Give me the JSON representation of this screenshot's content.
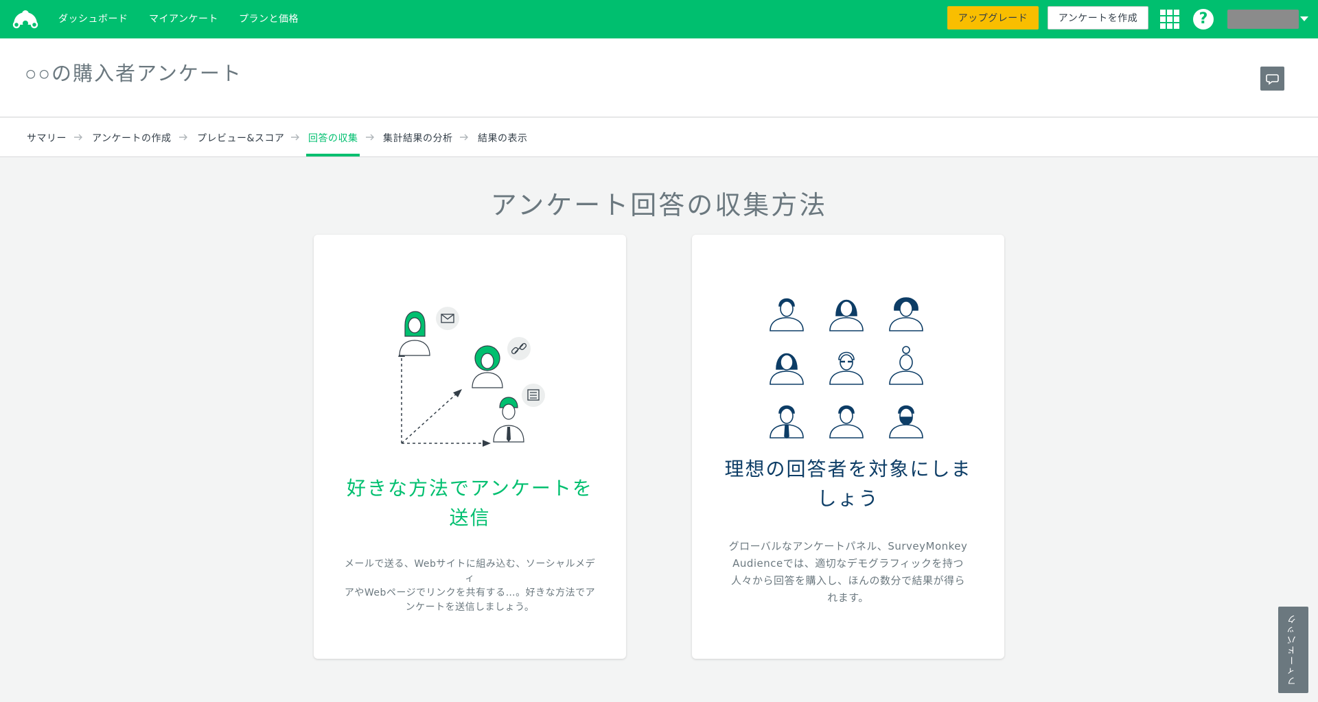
{
  "nav": {
    "links": [
      "ダッシュボード",
      "マイアンケート",
      "プランと価格"
    ],
    "upgrade_label": "アップグレード",
    "create_label": "アンケートを作成",
    "help_glyph": "?"
  },
  "survey": {
    "title": "○○の購入者アンケート"
  },
  "steps": [
    "サマリー",
    "アンケートの作成",
    "プレビュー&スコア",
    "回答の収集",
    "集計結果の分析",
    "結果の表示"
  ],
  "active_step": "回答の収集",
  "heading": "アンケート回答の収集方法",
  "cards": [
    {
      "title_line1": "好きな方法でアンケートを",
      "title_line2": "送信",
      "desc_lines": [
        "メールで送る、Webサイトに組み込む、ソーシャルメディ",
        "アやWebページでリンクを共有する…。好きな方法でア",
        "ンケートを送信しましょう。"
      ]
    },
    {
      "title_line1": "理想の回答者を対象にしま",
      "title_line2": "しょう",
      "desc_lines": [
        "グローバルなアンケートパネル、SurveyMonkey",
        "Audienceでは、適切なデモグラフィックを持つ",
        "人々から回答を購入し、ほんの数分で結果が得ら",
        "れます。"
      ]
    }
  ],
  "feedback_label": "フィードバック",
  "colors": {
    "brand": "#00bf6f",
    "upgrade": "#f9be00",
    "navy": "#0d3d66"
  }
}
